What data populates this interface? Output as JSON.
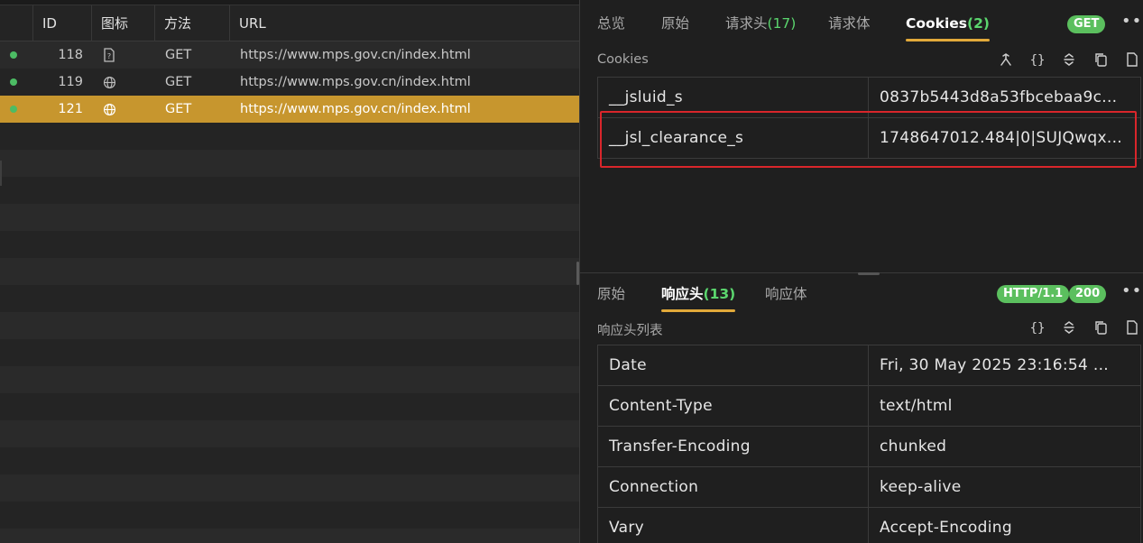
{
  "list": {
    "columns": [
      "ID",
      "图标",
      "方法",
      "URL"
    ],
    "rows": [
      {
        "id": "118",
        "icon": "document-icon",
        "method": "GET",
        "url": "https://www.mps.gov.cn/index.html",
        "selected": false
      },
      {
        "id": "119",
        "icon": "globe-icon",
        "method": "GET",
        "url": "https://www.mps.gov.cn/index.html",
        "selected": false
      },
      {
        "id": "121",
        "icon": "globe-icon",
        "method": "GET",
        "url": "https://www.mps.gov.cn/index.html",
        "selected": true
      }
    ],
    "status_dot_color": "#4cbc64",
    "selected_color": "#c7962e"
  },
  "request": {
    "tabs": [
      {
        "label": "总览",
        "count": ""
      },
      {
        "label": "原始",
        "count": ""
      },
      {
        "label": "请求头",
        "count": "(17)"
      },
      {
        "label": "请求体",
        "count": ""
      },
      {
        "label": "Cookies",
        "count": "(2)",
        "active": true
      }
    ],
    "method_badge": "GET",
    "more": "•••",
    "section_label": "Cookies",
    "cookies": [
      {
        "name": "__jsluid_s",
        "value": "0837b5443d8a53fbcebaa9c..."
      },
      {
        "name": "__jsl_clearance_s",
        "value": "1748647012.484|0|SUJQwqx..."
      }
    ]
  },
  "response": {
    "tabs": [
      {
        "label": "原始",
        "count": ""
      },
      {
        "label": "响应头",
        "count": "(13)",
        "active": true
      },
      {
        "label": "响应体",
        "count": ""
      }
    ],
    "protocol_badge": "HTTP/1.1",
    "status_badge": "200",
    "more": "•••",
    "section_label": "响应头列表",
    "headers": [
      {
        "name": "Date",
        "value": "Fri, 30 May 2025 23:16:54 ..."
      },
      {
        "name": "Content-Type",
        "value": "text/html"
      },
      {
        "name": "Transfer-Encoding",
        "value": "chunked"
      },
      {
        "name": "Connection",
        "value": "keep-alive"
      },
      {
        "name": "Vary",
        "value": "Accept-Encoding"
      }
    ]
  },
  "colors": {
    "accent": "#e2a93a",
    "count_green": "#5bd66e",
    "badge_green": "#5bbf5e",
    "highlight_red": "#d9262b"
  }
}
